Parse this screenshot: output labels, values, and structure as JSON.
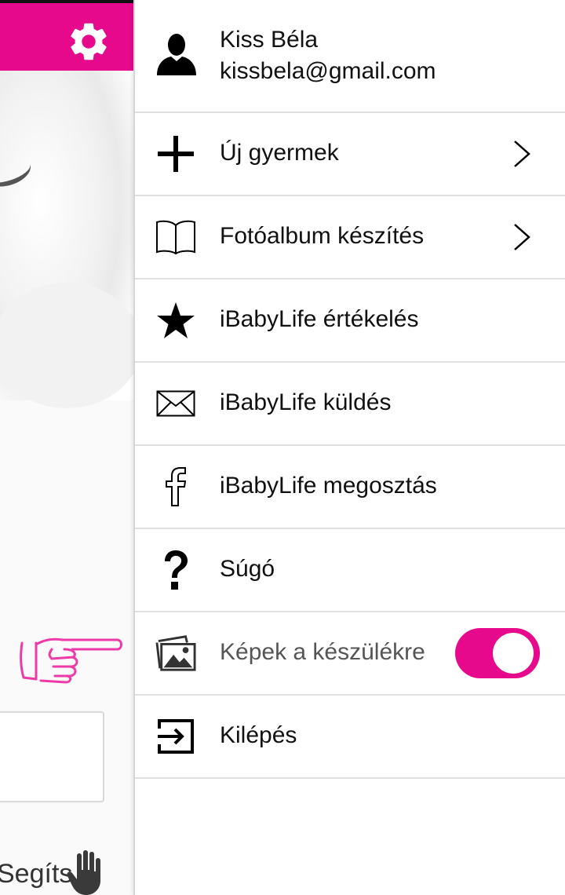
{
  "colors": {
    "accent": "#e6098c",
    "pointer": "#ee3aa9"
  },
  "background_app": {
    "settings_icon": "gear-icon",
    "help_text": "Segíts",
    "help_icon": "hand-icon",
    "pointer_icon": "pointing-hand-icon"
  },
  "drawer": {
    "profile": {
      "icon": "person-icon",
      "name": "Kiss Béla",
      "email": "kissbela@gmail.com"
    },
    "items": [
      {
        "label": "Új gyermek",
        "icon": "plus-icon",
        "chevron": true
      },
      {
        "label": "Fotóalbum készítés",
        "icon": "book-icon",
        "chevron": true
      },
      {
        "label": "iBabyLife értékelés",
        "icon": "star-icon"
      },
      {
        "label": "iBabyLife küldés",
        "icon": "envelope-icon"
      },
      {
        "label": "iBabyLife megosztás",
        "icon": "facebook-icon"
      },
      {
        "label": "Súgó",
        "icon": "question-icon"
      },
      {
        "label": "Képek a készülékre",
        "icon": "photos-icon",
        "toggle": true,
        "toggle_on": true
      },
      {
        "label": "Kilépés",
        "icon": "logout-icon"
      }
    ]
  }
}
